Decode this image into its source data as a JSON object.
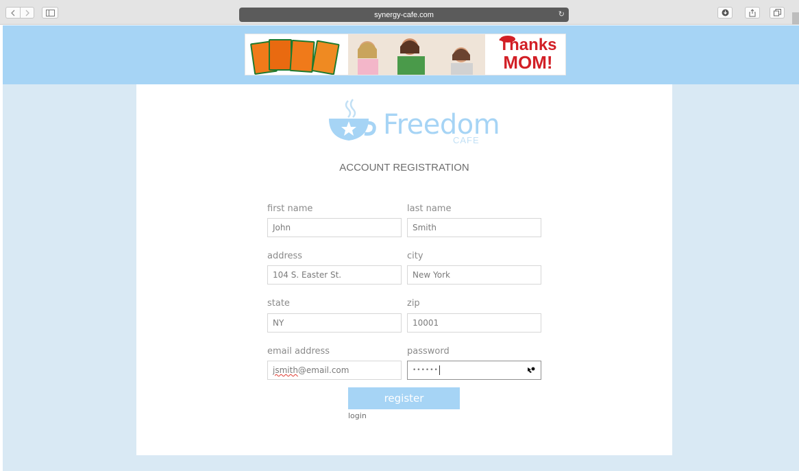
{
  "browser": {
    "url": "synergy-cafe.com"
  },
  "ad": {
    "line1": "Thanks",
    "line2": "MOM!",
    "brand_color": "#d21f26"
  },
  "logo": {
    "name": "Freedom",
    "sub": "CAFE",
    "icon": "coffee-cup-star-icon"
  },
  "form": {
    "title": "ACCOUNT REGISTRATION",
    "fields": {
      "first_name": {
        "label": "first name",
        "value": "John"
      },
      "last_name": {
        "label": "last name",
        "value": "Smith"
      },
      "address": {
        "label": "address",
        "value": "104 S. Easter St."
      },
      "city": {
        "label": "city",
        "value": "New York"
      },
      "state": {
        "label": "state",
        "value": "NY"
      },
      "zip": {
        "label": "zip",
        "value": "10001"
      },
      "email": {
        "label": "email address",
        "value_prefix": "jsmith",
        "value_suffix": "@email.com"
      },
      "password": {
        "label": "password",
        "value": "••••••"
      }
    },
    "register_label": "register",
    "login_label": "login"
  },
  "colors": {
    "accent": "#a6d4f5",
    "page_bg": "#d9e9f4"
  }
}
